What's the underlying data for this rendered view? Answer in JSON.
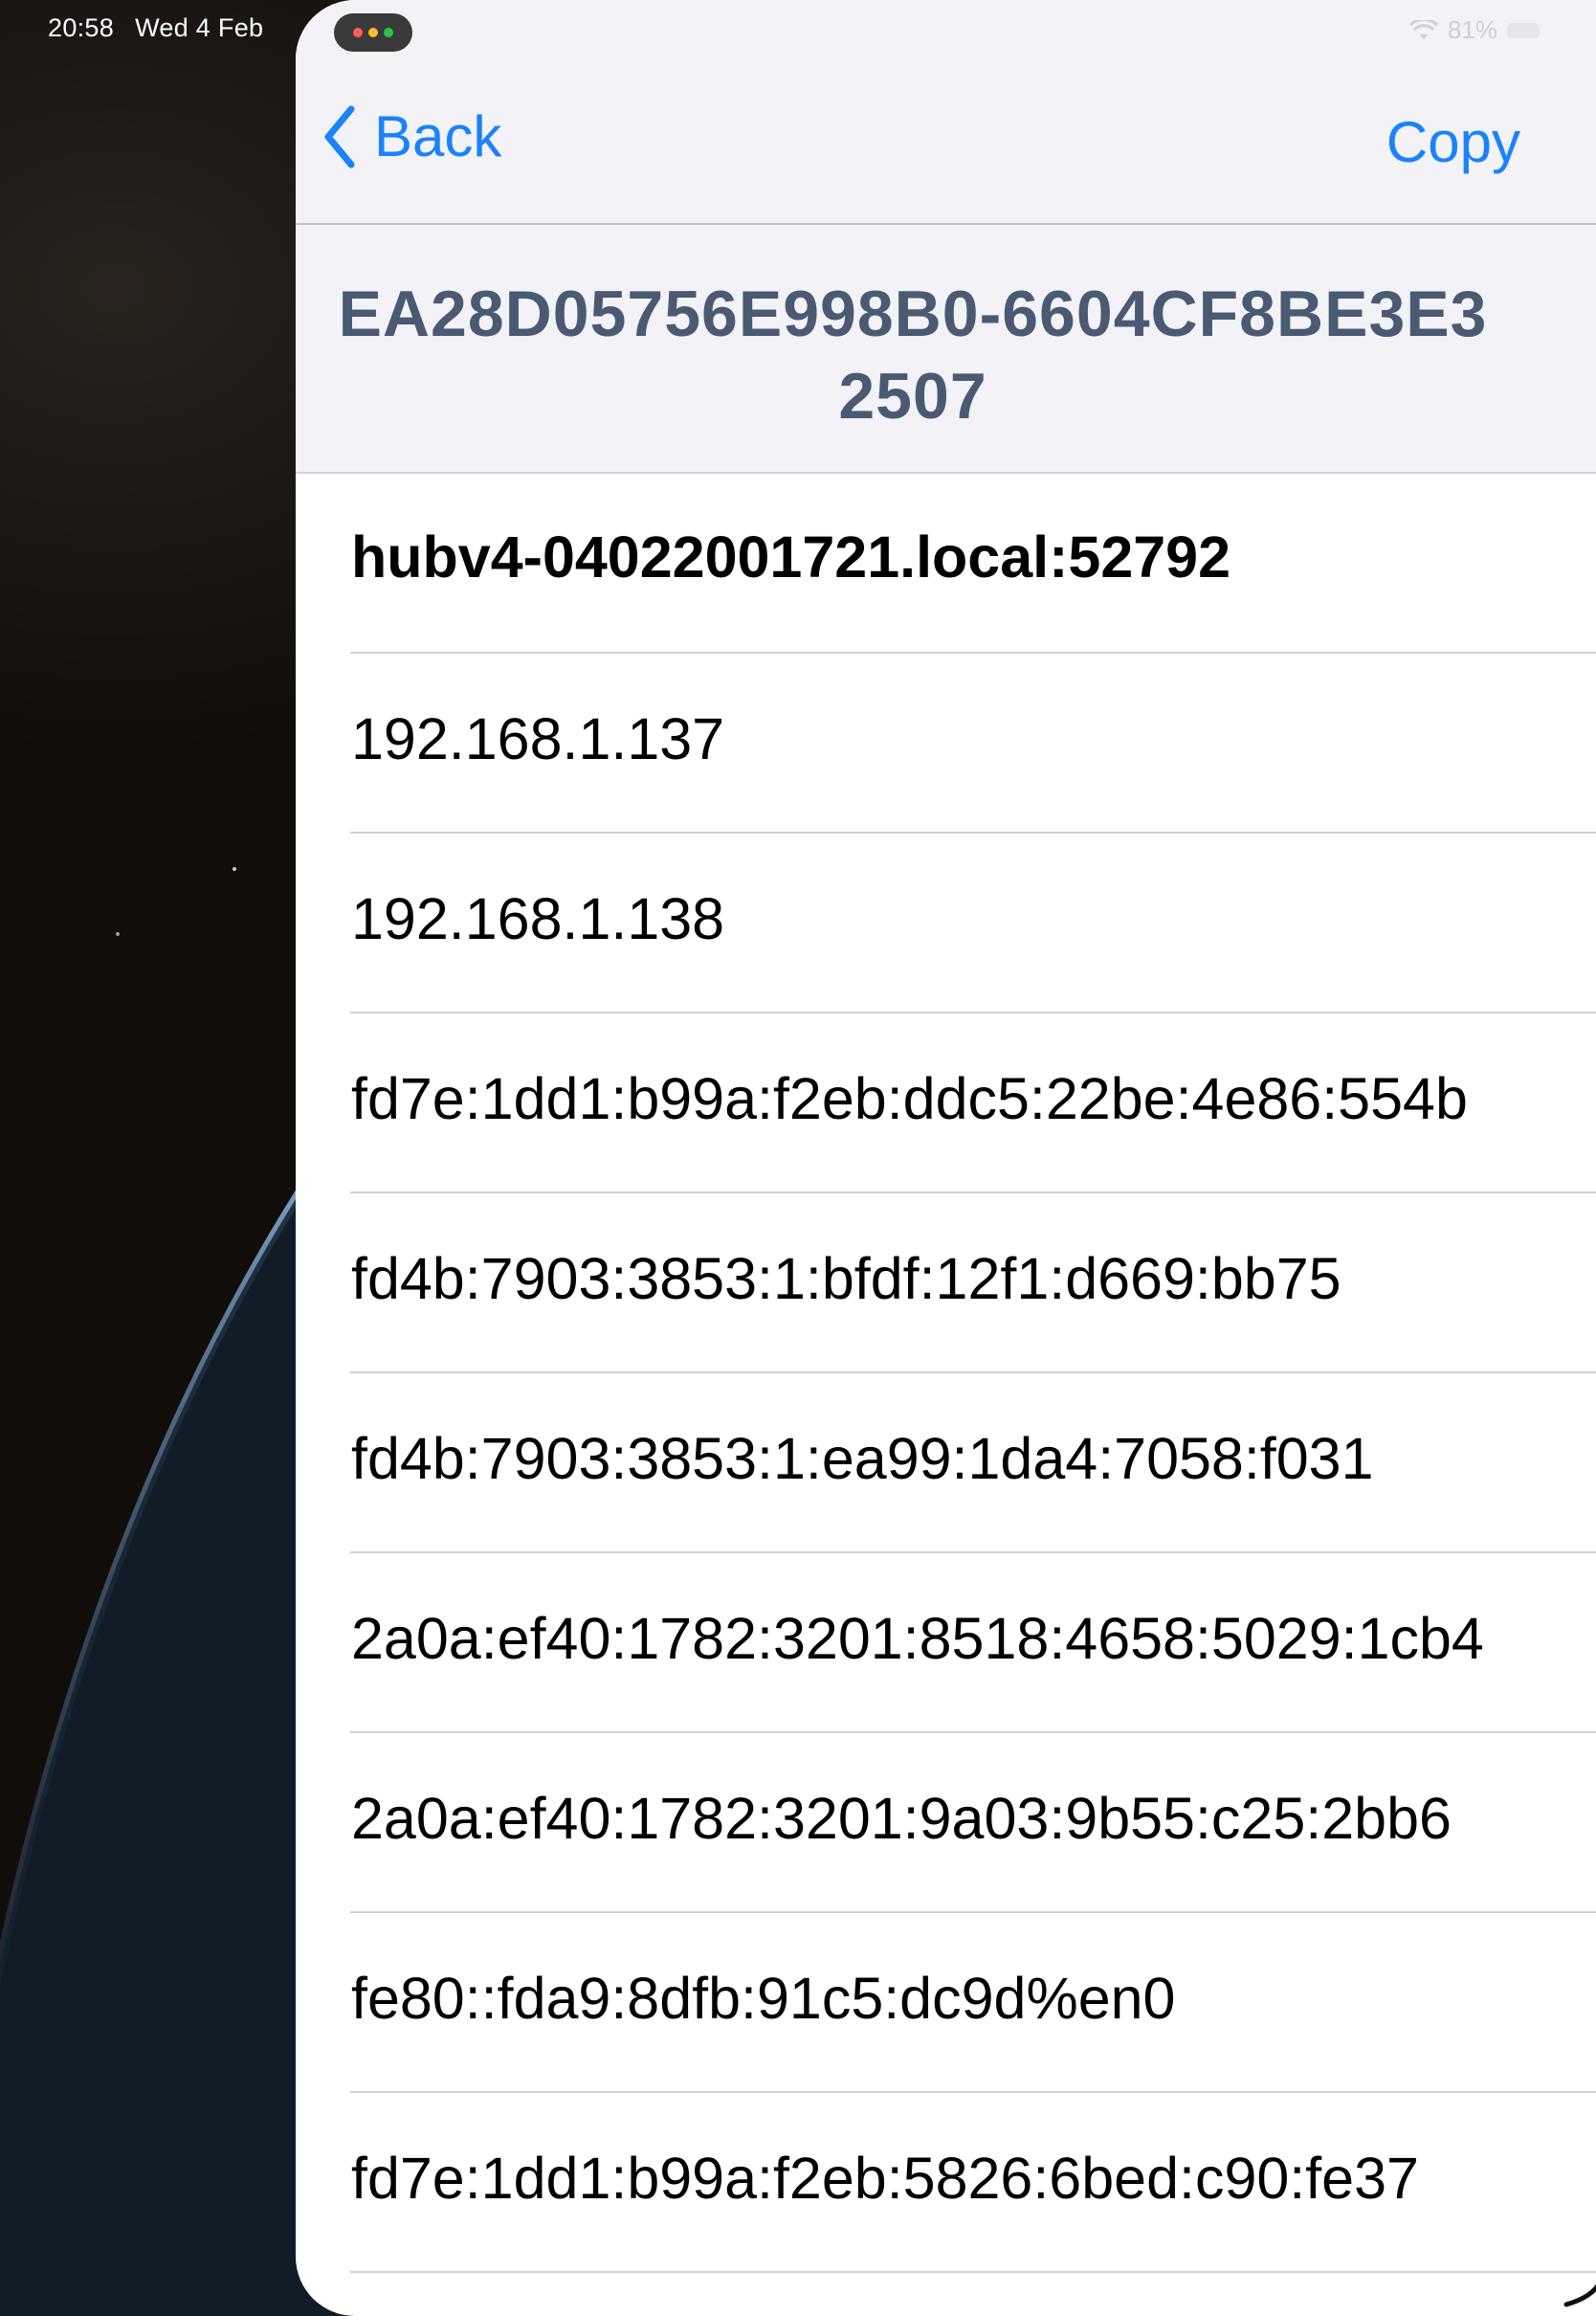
{
  "status_bar": {
    "time": "20:58",
    "date": "Wed 4 Feb",
    "battery_percent": "81%",
    "wifi_icon": "wifi-icon",
    "battery_icon": "battery-icon"
  },
  "multitask": {
    "dots": [
      "#ff5f57",
      "#febc2e",
      "#28c840"
    ]
  },
  "navigation": {
    "back_label": "Back",
    "copy_label": "Copy"
  },
  "header": {
    "title": "EA28D05756E998B0-6604CF8BE3E32507"
  },
  "addresses": [
    "hubv4-04022001721.local:52792",
    "192.168.1.137",
    "192.168.1.138",
    "fd7e:1dd1:b99a:f2eb:ddc5:22be:4e86:554b",
    "fd4b:7903:3853:1:bfdf:12f1:d669:bb75",
    "fd4b:7903:3853:1:ea99:1da4:7058:f031",
    "2a0a:ef40:1782:3201:8518:4658:5029:1cb4",
    "2a0a:ef40:1782:3201:9a03:9b55:c25:2bb6",
    "fe80::fda9:8dfb:91c5:dc9d%en0",
    "fd7e:1dd1:b99a:f2eb:5826:6bed:c90:fe37"
  ],
  "colors": {
    "accent": "#1a82fb",
    "header_text": "#4a5a72",
    "nav_background": "#f2f2f7",
    "separator": "#d1d1d6"
  }
}
